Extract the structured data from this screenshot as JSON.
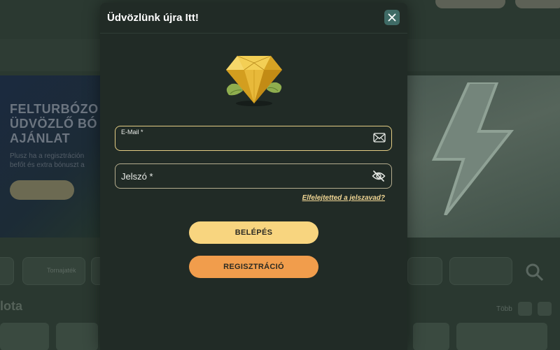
{
  "modal": {
    "title": "Üdvözlünk újra Itt!",
    "email_label": "E-Mail *",
    "password_label": "Jelszó *",
    "forgot_link": "Elfelejtetted a jelszavad?",
    "login_button": "BELÉPÉS",
    "register_button": "REGISZTRÁCIÓ",
    "icons": [
      "close-icon",
      "diamond-icon",
      "envelope-icon",
      "eye-off-icon"
    ]
  },
  "background": {
    "banner_title": [
      "FELTURBÓZO",
      "ÜDVÖZLŐ BÓ",
      "AJÁNLAT"
    ],
    "banner_sub": [
      "Plusz ha a regisztráción",
      "befőt és extra bónuszt a"
    ],
    "chip_label": "Tornajaték",
    "section_title": "lota",
    "view_label": "Több"
  },
  "colors": {
    "accent_yellow": "#f8d57f",
    "accent_orange": "#f19d4c",
    "modal_bg": "#212b26",
    "close_bg": "#3f6b66"
  }
}
